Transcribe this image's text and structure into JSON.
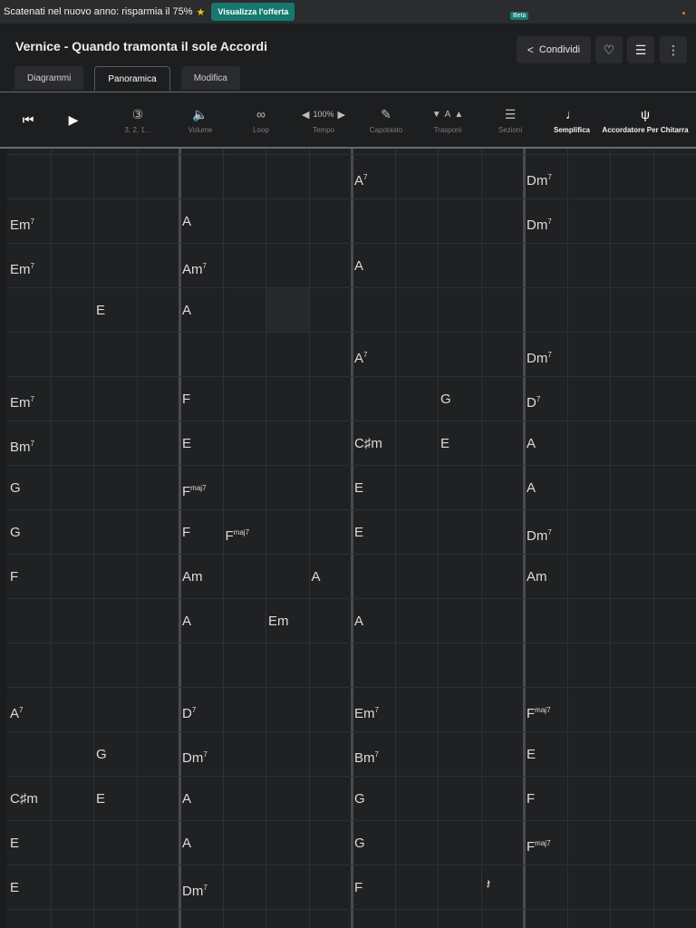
{
  "promo": {
    "text": "Scatenati nel nuovo anno: risparmia il 75%",
    "button": "Visualizza l'offerta"
  },
  "header": {
    "title": "Vernice - Quando tramonta il sole Accordi",
    "share": "Condividi",
    "tabs": [
      "Diagrammi",
      "Panoramica",
      "Modifica"
    ],
    "active_tab": "Panoramica"
  },
  "toolbar": {
    "count_label": "3, 2, 1...",
    "volume": "Volume",
    "loop": "Loop",
    "tempo_value": "100%",
    "tempo": "Tempo",
    "capo": "Capotasto",
    "transpose_value": "A",
    "transpose": "Trasponi",
    "sections": "Sezioni",
    "beta": "Beta",
    "simplify": "Semplifica",
    "tuner": "Accordatore Per Chitarra"
  },
  "grid": {
    "rows": [
      [
        "",
        "",
        "",
        "",
        "",
        "",
        "",
        "",
        "A|7",
        "",
        "",
        "",
        "Dm|7",
        "",
        "",
        ""
      ],
      [
        "Em|7",
        "",
        "",
        "",
        "A",
        "",
        "",
        "",
        "",
        "",
        "",
        "",
        "Dm|7",
        "",
        "",
        ""
      ],
      [
        "Em|7",
        "",
        "",
        "",
        "Am|7",
        "",
        "",
        "",
        "A",
        "",
        "",
        "",
        "",
        "",
        "",
        ""
      ],
      [
        "",
        "",
        "E",
        "",
        "A",
        "",
        "",
        "",
        "",
        "",
        "",
        "",
        "",
        "",
        "",
        ""
      ],
      [
        "",
        "",
        "",
        "",
        "",
        "",
        "",
        "",
        "A|7",
        "",
        "",
        "",
        "Dm|7",
        "",
        "",
        ""
      ],
      [
        "Em|7",
        "",
        "",
        "",
        "F",
        "",
        "",
        "",
        "",
        "",
        "G",
        "",
        "D|7",
        "",
        "",
        ""
      ],
      [
        "Bm|7",
        "",
        "",
        "",
        "E",
        "",
        "",
        "",
        "C♯m",
        "",
        "E",
        "",
        "A",
        "",
        "",
        ""
      ],
      [
        "G",
        "",
        "",
        "",
        "F|maj7",
        "",
        "",
        "",
        "E",
        "",
        "",
        "",
        "A",
        "",
        "",
        ""
      ],
      [
        "G",
        "",
        "",
        "",
        "F",
        "F|maj7",
        "",
        "",
        "E",
        "",
        "",
        "",
        "Dm|7",
        "",
        "",
        ""
      ],
      [
        "F",
        "",
        "",
        "",
        "Am",
        "",
        "",
        "A",
        "",
        "",
        "",
        "",
        "Am",
        "",
        "",
        ""
      ],
      [
        "",
        "",
        "",
        "",
        "A",
        "",
        "Em",
        "",
        "A",
        "",
        "",
        "",
        "",
        "",
        "",
        ""
      ],
      [
        "",
        "",
        "",
        "",
        "",
        "",
        "",
        "",
        "",
        "",
        "",
        "",
        "",
        "",
        "",
        ""
      ],
      [
        "A|7",
        "",
        "",
        "",
        "D|7",
        "",
        "",
        "",
        "Em|7",
        "",
        "",
        "",
        "F|maj7",
        "",
        "",
        ""
      ],
      [
        "",
        "",
        "G",
        "",
        "Dm|7",
        "",
        "",
        "",
        "Bm|7",
        "",
        "",
        "",
        "E",
        "",
        "",
        ""
      ],
      [
        "C♯m",
        "",
        "E",
        "",
        "A",
        "",
        "",
        "",
        "G",
        "",
        "",
        "",
        "F",
        "",
        "",
        ""
      ],
      [
        "E",
        "",
        "",
        "",
        "A",
        "",
        "",
        "",
        "G",
        "",
        "",
        "",
        "F|maj7",
        "",
        "",
        ""
      ],
      [
        "E",
        "",
        "",
        "",
        "Dm|7",
        "",
        "",
        "",
        "F",
        "",
        "",
        "𝄽",
        "",
        "",
        "",
        ""
      ]
    ]
  }
}
